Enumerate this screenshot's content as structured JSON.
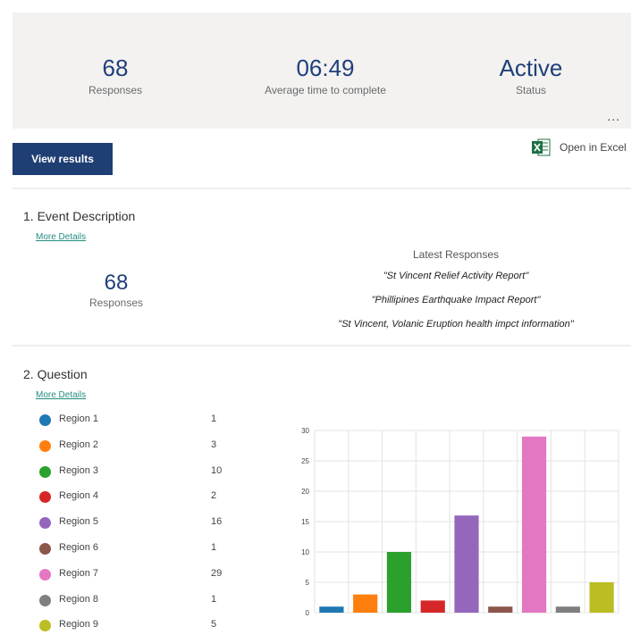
{
  "summary": {
    "stats": [
      {
        "value": "68",
        "label": "Responses"
      },
      {
        "value": "06:49",
        "label": "Average time to complete"
      },
      {
        "value": "Active",
        "label": "Status"
      }
    ],
    "more_label": "..."
  },
  "toolbar": {
    "view_results_label": "View results",
    "open_excel_label": "Open in Excel",
    "excel_icon": "excel-icon"
  },
  "questions": [
    {
      "number_title": "1.  Event Description",
      "more_details": "More Details",
      "responses_value": "68",
      "responses_label": "Responses",
      "latest_title": "Latest Responses",
      "latest_items": [
        "\"St Vincent Relief Activity Report\"",
        "\"Phillipines Earthquake Impact Report\"",
        "\"St Vincent, Volanic Eruption health impct information\""
      ]
    },
    {
      "number_title": "2.  Question",
      "more_details": "More Details"
    }
  ],
  "chart_data": {
    "type": "bar",
    "categories": [
      "Region 1",
      "Region 2",
      "Region 3",
      "Region 4",
      "Region 5",
      "Region 6",
      "Region 7",
      "Region 8",
      "Region 9"
    ],
    "values": [
      1,
      3,
      10,
      2,
      16,
      1,
      29,
      1,
      5
    ],
    "colors": [
      "#1f77b4",
      "#ff7f0e",
      "#2ca02c",
      "#d62728",
      "#9467bd",
      "#8c564b",
      "#e377c2",
      "#7f7f7f",
      "#bcbd22"
    ],
    "ylim": [
      0,
      30
    ],
    "yticks": [
      "0",
      "5",
      "10",
      "15",
      "20",
      "25",
      "30"
    ],
    "grid": true,
    "legend_placement": "left"
  }
}
